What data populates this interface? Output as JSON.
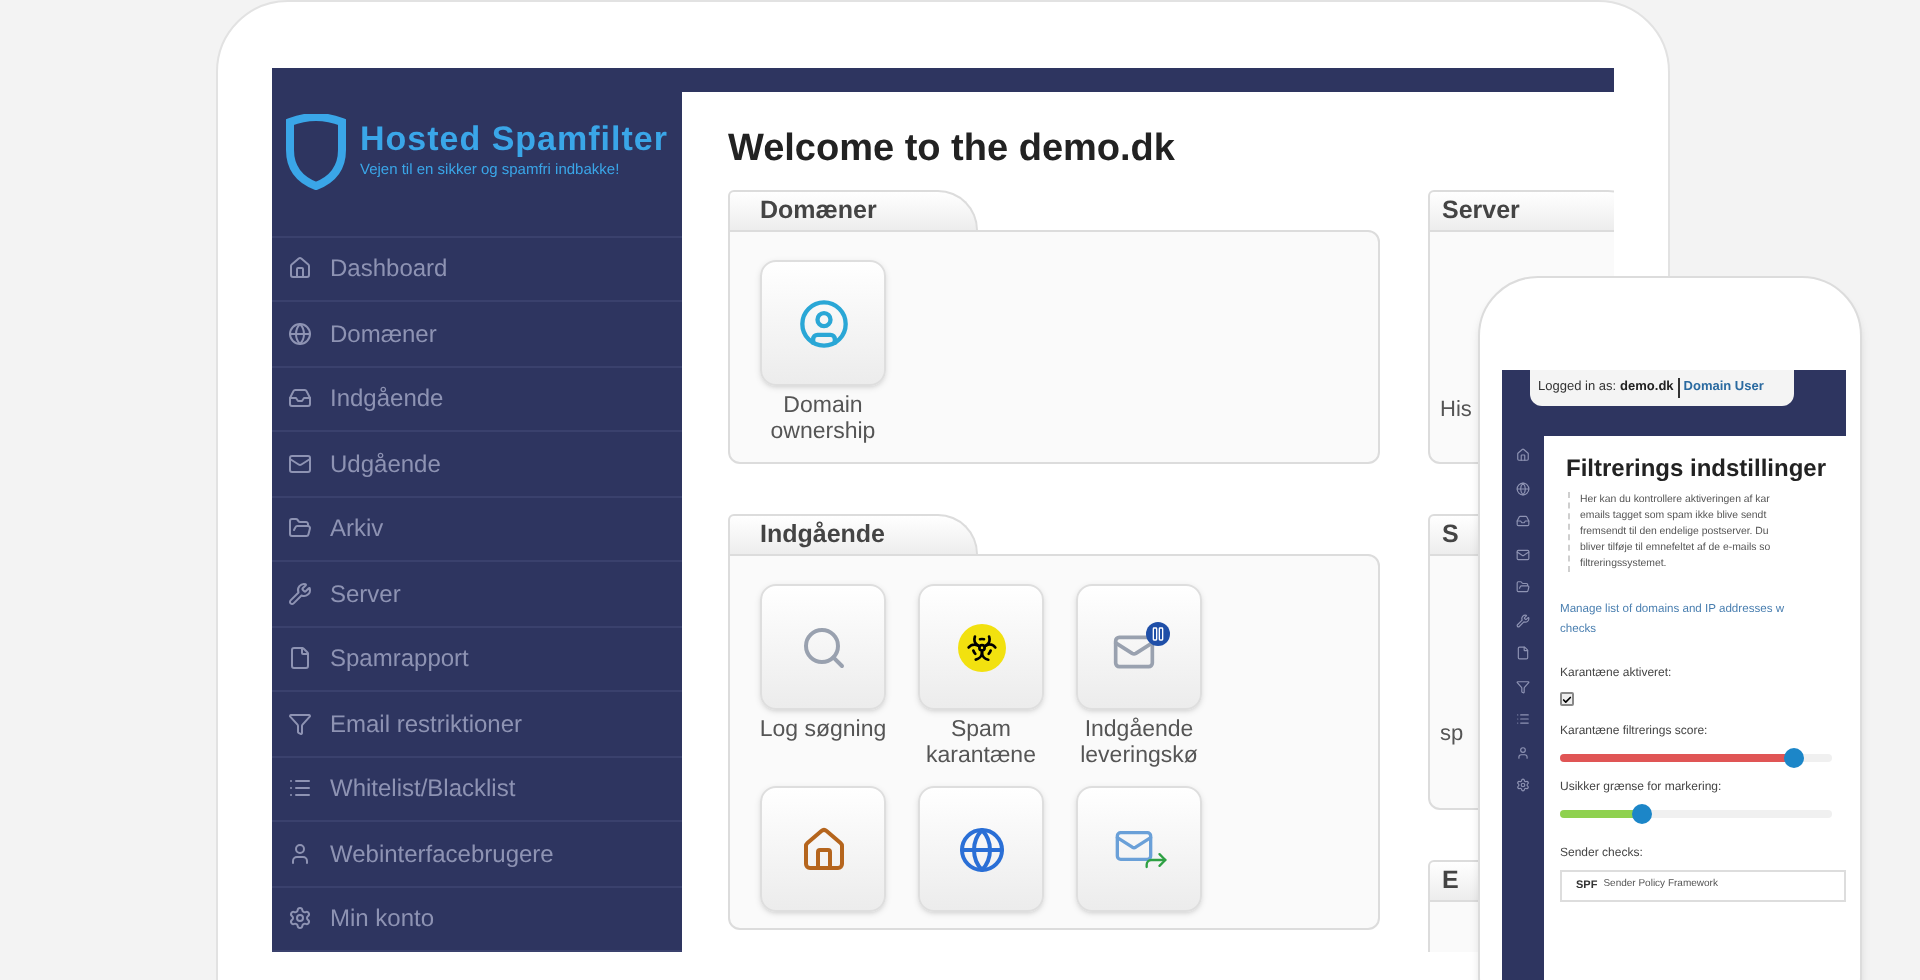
{
  "tablet": {
    "logo": {
      "title": "Hosted Spamfilter",
      "tagline": "Vejen til en sikker og spamfri indbakke!"
    },
    "sidebar": {
      "items": [
        {
          "label": "Dashboard"
        },
        {
          "label": "Domæner"
        },
        {
          "label": "Indgående"
        },
        {
          "label": "Udgående"
        },
        {
          "label": "Arkiv"
        },
        {
          "label": "Server"
        },
        {
          "label": "Spamrapport"
        },
        {
          "label": "Email restriktioner"
        },
        {
          "label": "Whitelist/Blacklist"
        },
        {
          "label": "Webinterfacebrugere"
        },
        {
          "label": "Min konto"
        }
      ]
    },
    "page_title": "Welcome to the demo.dk",
    "panels": [
      {
        "title": "Domæner",
        "tiles": [
          {
            "kind": "ownership",
            "label": "Domain ownership"
          }
        ]
      },
      {
        "title": "Indgående",
        "tiles": [
          {
            "kind": "search",
            "label": "Log søgning"
          },
          {
            "kind": "biohazard",
            "label": "Spam karantæne"
          },
          {
            "kind": "mail-paused",
            "label": "Indgående leveringskø"
          },
          {
            "kind": "home"
          },
          {
            "kind": "globe"
          },
          {
            "kind": "mail-forward"
          }
        ]
      }
    ],
    "side_panels": [
      {
        "title": "Server",
        "tile_label": "His"
      },
      {
        "title": "S",
        "tile_label": "sp"
      },
      {
        "title": "E"
      }
    ]
  },
  "phone": {
    "login": {
      "prefix": "Logged in as:",
      "user": "demo.dk",
      "role": "Domain User"
    },
    "title": "Filtrerings indstillinger",
    "description_lines": [
      "Her kan du kontrollere aktiveringen af kar",
      "emails tagget som spam ikke blive sendt",
      "fremsendt til den endelige postserver. Du",
      "bliver tilføje til emnefeltet af de e-mails so",
      "filtreringssystemet."
    ],
    "link_lines": [
      "Manage list of domains and IP addresses w",
      "checks"
    ],
    "checkbox": {
      "label": "Karantæne aktiveret:",
      "checked": true
    },
    "sliders": [
      {
        "label": "Karantæne filtrerings score:",
        "level": 0.86,
        "color": "#e05555"
      },
      {
        "label": "Usikker grænse for markering:",
        "level": 0.3,
        "color": "#8fd14f"
      }
    ],
    "sender_checks": {
      "label": "Sender checks:",
      "rows": [
        {
          "code": "SPF",
          "description": "Sender Policy Framework"
        }
      ]
    }
  }
}
